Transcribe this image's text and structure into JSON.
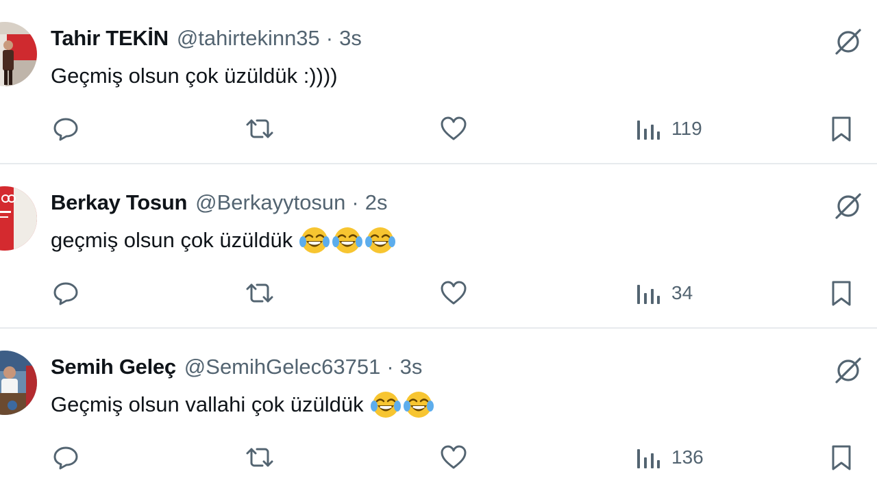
{
  "colors": {
    "text_primary": "#0f1419",
    "text_secondary": "#536471",
    "divider": "#e7eaed"
  },
  "tweets": [
    {
      "display_name": "Tahir TEKİN",
      "handle": "@tahirtekinn35",
      "separator": "·",
      "time": "3s",
      "text": "Geçmiş olsun çok üzüldük :))))",
      "emoji_count": 0,
      "views": "119",
      "icons": [
        "reply-icon",
        "retweet-icon",
        "like-icon",
        "views-icon",
        "bookmark-icon",
        "grok-icon"
      ]
    },
    {
      "display_name": "Berkay Tosun",
      "handle": "@Berkayytosun",
      "separator": "·",
      "time": "2s",
      "text": "geçmiş olsun çok üzüldük",
      "emoji_count": 3,
      "views": "34",
      "icons": [
        "reply-icon",
        "retweet-icon",
        "like-icon",
        "views-icon",
        "bookmark-icon",
        "grok-icon"
      ]
    },
    {
      "display_name": "Semih Geleç",
      "handle": "@SemihGelec63751",
      "separator": "·",
      "time": "3s",
      "text": "Geçmiş olsun vallahi çok üzüldük",
      "emoji_count": 2,
      "views": "136",
      "icons": [
        "reply-icon",
        "retweet-icon",
        "like-icon",
        "views-icon",
        "bookmark-icon",
        "grok-icon"
      ]
    }
  ]
}
